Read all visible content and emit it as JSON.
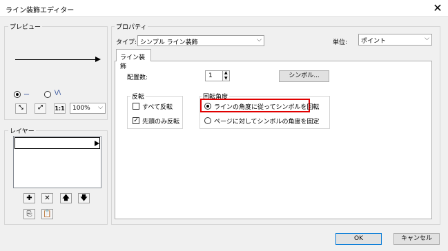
{
  "window": {
    "title": "ライン装飾エディター"
  },
  "preview": {
    "group_label": "プレビュー",
    "radio_line_label": "ー",
    "radio_wave_label": "\\/\\",
    "btn_shrink": "⤡",
    "btn_expand": "⤢",
    "btn_actual": "1:1",
    "zoom_value": "100%"
  },
  "layer": {
    "group_label": "レイヤー"
  },
  "properties": {
    "group_label": "プロパティ",
    "type_label": "タイプ:",
    "type_value": "シンプル ライン装飾",
    "unit_label": "単位:",
    "unit_value": "ポイント",
    "tab_label": "ライン装飾",
    "count_label": "配置数:",
    "count_value": "1",
    "symbol_button": "シンボル...",
    "flip_label": "反転",
    "flip_all": "すべて反転",
    "flip_first": "先頭のみ反転",
    "rotation_label": "回転角度",
    "rotate_along": "ラインの角度に従ってシンボルを回転",
    "rotate_page": "ページに対してシンボルの角度を固定"
  },
  "footer": {
    "ok": "OK",
    "cancel": "キャンセル"
  },
  "colors": {
    "highlight": "#e00000",
    "title_bg": "#ffffff",
    "dialog_bg": "#f0f0f0"
  }
}
